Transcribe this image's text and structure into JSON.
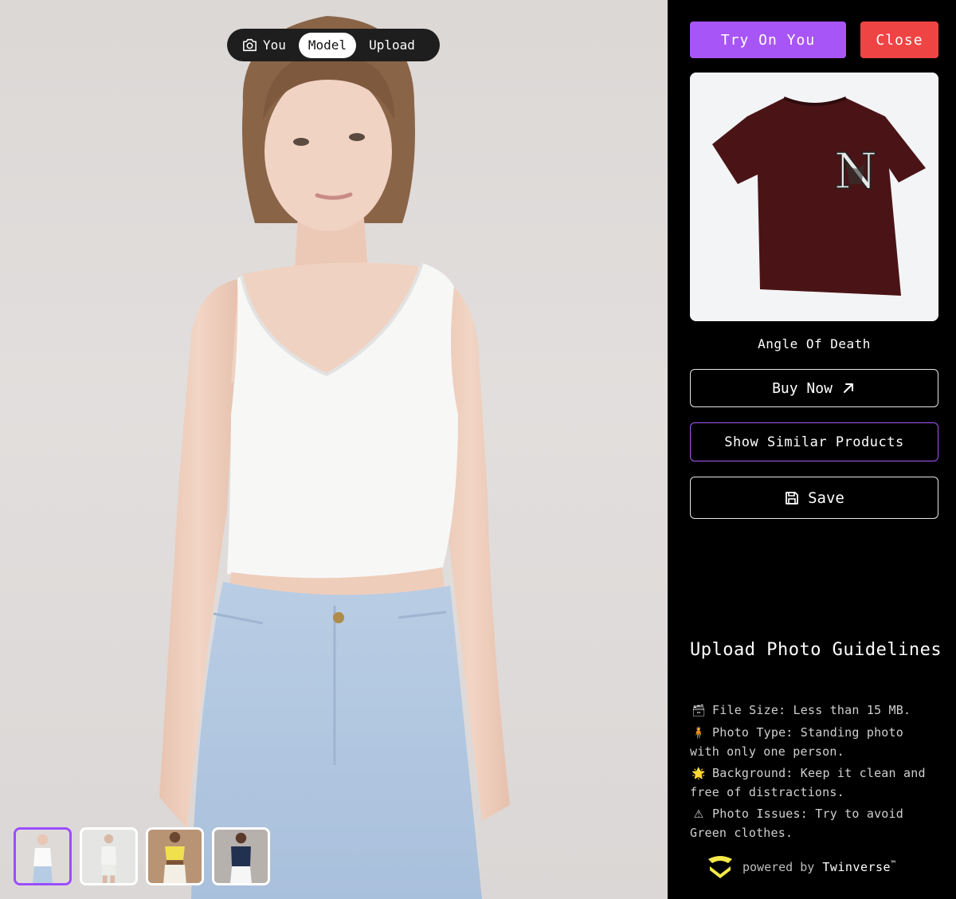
{
  "mode_switch": {
    "options": [
      {
        "label": "You",
        "icon": "camera-icon",
        "active": false
      },
      {
        "label": "Model",
        "active": true
      },
      {
        "label": "Upload",
        "active": false
      }
    ]
  },
  "thumbnails": [
    {
      "name": "white tank model",
      "active": true
    },
    {
      "name": "white outfit model",
      "active": false
    },
    {
      "name": "yellow top model",
      "active": false
    },
    {
      "name": "navy tank model",
      "active": false
    }
  ],
  "actions": {
    "try_on_label": "Try On You",
    "close_label": "Close"
  },
  "product": {
    "name": "Angle Of Death",
    "color": "#4a1416"
  },
  "buttons": {
    "buy_now": "Buy Now",
    "show_similar": "Show Similar Products",
    "save": "Save"
  },
  "guidelines": {
    "title": "Upload Photo Guidelines",
    "items": [
      {
        "icon": "🗃",
        "text": "File Size: Less than 15 MB."
      },
      {
        "icon": "🧍",
        "text": "Photo Type: Standing photo with only one person."
      },
      {
        "icon": "🌟",
        "text": "Background: Keep it clean and free of distractions."
      },
      {
        "icon": "⚠",
        "text": "Photo Issues: Try to avoid Green clothes."
      }
    ]
  },
  "footer": {
    "powered_by": "powered by",
    "brand": "Twinverse",
    "tm": "™"
  },
  "colors": {
    "accent": "#a855f7",
    "danger": "#ef4444",
    "sidebar_bg": "#000000"
  }
}
